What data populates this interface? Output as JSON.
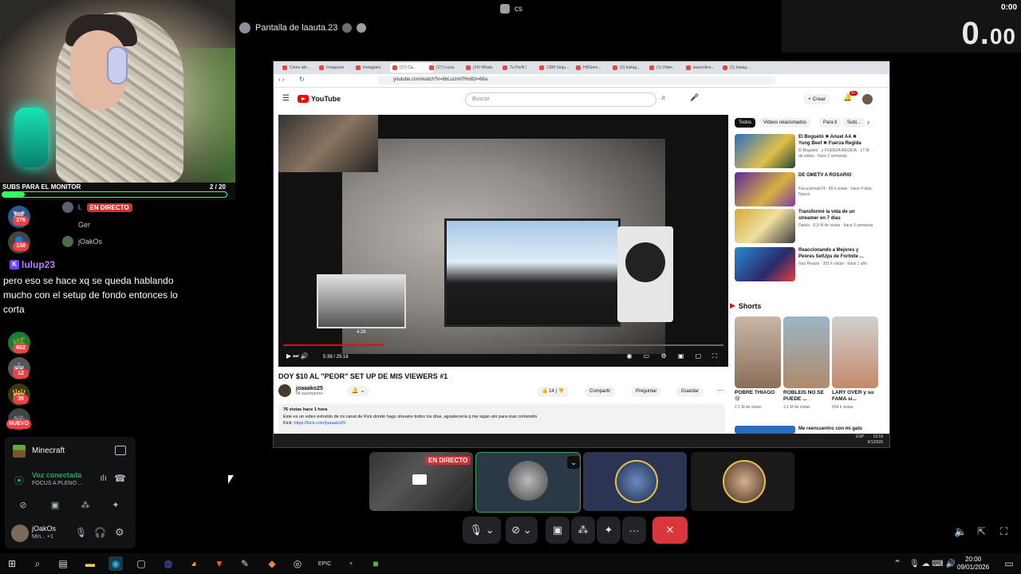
{
  "top": {
    "user_label": "cs"
  },
  "timer": {
    "small": "0:00",
    "big_int": "0.",
    "big_dec": "00"
  },
  "overlay": {
    "sub_goal_label": "SUBS PARA EL MONITOR",
    "sub_goal_count": "2 / 20"
  },
  "servers": [
    {
      "badge": "376"
    },
    {
      "badge": "138"
    },
    {
      "badge": ""
    },
    {
      "badge": "602"
    },
    {
      "badge": "12"
    },
    {
      "badge": "35"
    },
    {
      "badge": "NUEVO"
    }
  ],
  "voice_channel": {
    "live_label": "EN DIRECTO",
    "users": [
      "l.",
      "Ger",
      "jOakOs"
    ]
  },
  "chat": {
    "username": "lulup23",
    "message": "pero eso se hace xq se queda hablando mucho con el setup de fondo entonces lo corta"
  },
  "left_panel": {
    "activity": "Minecraft",
    "voice_status": "Voz conectada",
    "voice_sub": "FOCUS A PLENO ...",
    "user_name": "jOakOs",
    "user_status": "Min... +1"
  },
  "share": {
    "title": "Pantalla de laauta.23"
  },
  "browser": {
    "tabs": [
      "Cómo abr...",
      "Instagram",
      "Instagram",
      "(17) Ca...",
      "(17) Lucia",
      "(24) Whats",
      "Tu Perfil |",
      "CBM Segu...",
      "Hi5Gem...",
      "(2) Instag...",
      "(1) Video",
      "laucholino...",
      "(1) Instag..."
    ],
    "url": "youtube.com/watch?v=6bLucIml?Ho8zl=66a"
  },
  "youtube": {
    "logo": "YouTube",
    "search_placeholder": "Buscar",
    "create_label": "+ Crear",
    "notif_count": "9+",
    "video_title": "DOY $10 AL \"PEOR\" SET UP DE MIS VIEWERS #1",
    "channel_name": "joaaako25",
    "channel_subs": "58 suscriptores",
    "likes": "14",
    "share": "Compartir",
    "ask": "Preguntar",
    "save": "Guardar",
    "time_display": "5:38 / 25:16",
    "preview_time": "4:26",
    "desc_meta": "76 vistas  hace 1 hora",
    "desc_line1": "Este es un video extraído de mi canal de Kick donde hago streams todos los días, agradecería q me sigan ahí para mas contenido",
    "desc_kick_label": "Kick:",
    "desc_kick_link": "https://kick.com/joaaako25",
    "chips": [
      "Todos",
      "Videos relacionados",
      "Para ti",
      "Subi..."
    ],
    "recs": [
      {
        "title": "El Boguetó ✖ Anuel AA ✖ Yung Beef ✖ Fuerza Regida",
        "meta": "El Boguetó · y FUERZA REGIDA · 17 M de vistas · hace 2 semanas",
        "duration": "3:58"
      },
      {
        "title": "DE OMETV A ROSARIO",
        "meta": "Facucorman74 · 90 k vistas · hace 4 días · Nuevo",
        "duration": "20:56"
      },
      {
        "title": "Transformé la vida de un streamer en 7 días",
        "meta": "Danilo · 5,9 M de vistas · hace 3 semanas",
        "duration": "21:21"
      },
      {
        "title": "Reaccionando a Mejores y Peores SetUps de Fortnite ...",
        "meta": "Gaz Reacts · 351 k vistas · hace 1 año",
        "duration": "21:09"
      }
    ],
    "shorts_label": "Shorts",
    "shorts": [
      {
        "title": "POBRE THIAGO 😢",
        "meta": "2,1 M de vistas"
      },
      {
        "title": "ROBLEIS NO SE PUEDE ...",
        "meta": "3,1 M de vistas"
      },
      {
        "title": "LARY OVER y su FAMA si...",
        "meta": "654 k vistas"
      }
    ],
    "last_rec": "Me reencuentro con mi gato"
  },
  "inner_taskbar": {
    "lang": "ESP",
    "time": "19:18",
    "date": "9/1/2026"
  },
  "tiles": {
    "live_label": "EN DIRECTO"
  },
  "taskbar": {
    "time": "20:00",
    "date": "09/01/2026"
  }
}
